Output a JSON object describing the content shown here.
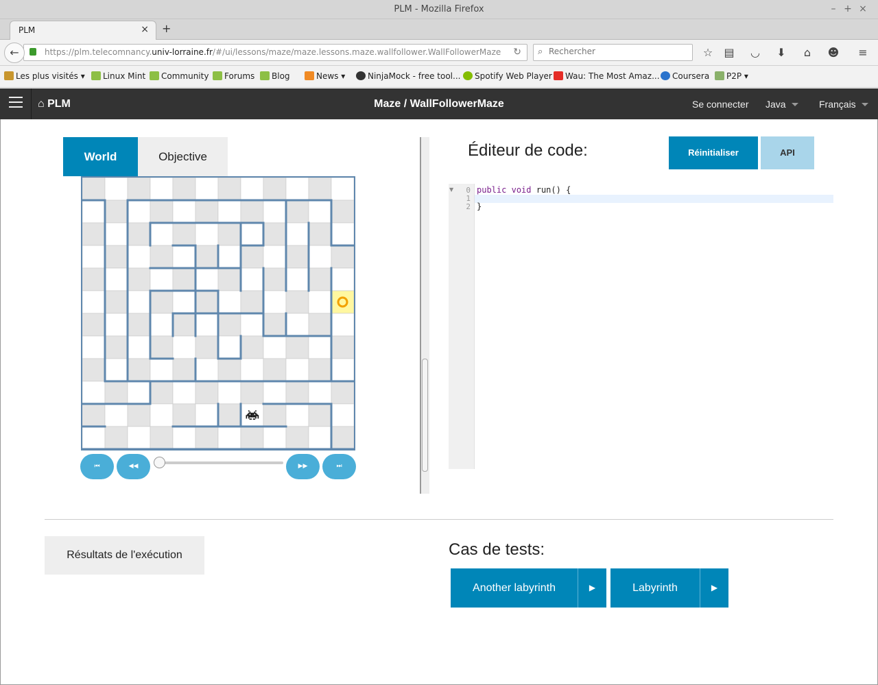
{
  "browser": {
    "window_title": "PLM - Mozilla Firefox",
    "tab_title": "PLM",
    "url_prefix": "https://plm.telecomnancy.",
    "url_domain": "univ-lorraine.fr",
    "url_path": "/#/ui/lessons/maze/maze.lessons.maze.wallfollower.WallFollowerMaze",
    "search_placeholder": "Rechercher",
    "bookmarks": [
      {
        "label": "Les plus visités",
        "icon": "folder-icon",
        "dropdown": true
      },
      {
        "label": "Linux Mint",
        "icon": "mint-icon"
      },
      {
        "label": "Community",
        "icon": "mint-icon"
      },
      {
        "label": "Forums",
        "icon": "mint-icon"
      },
      {
        "label": "Blog",
        "icon": "mint-icon"
      },
      {
        "label": "News",
        "icon": "rss-icon",
        "dropdown": true
      },
      {
        "label": "NinjaMock - free tool...",
        "icon": "ninja-icon"
      },
      {
        "label": "Spotify Web Player",
        "icon": "spotify-icon"
      },
      {
        "label": "Wau: The Most Amaz...",
        "icon": "youtube-icon"
      },
      {
        "label": "Coursera",
        "icon": "coursera-icon"
      },
      {
        "label": "P2P",
        "icon": "folder-icon",
        "dropdown": true
      }
    ]
  },
  "app": {
    "brand": "PLM",
    "title": "Maze / WallFollowerMaze",
    "login": "Se connecter",
    "language": "Java",
    "locale": "Français"
  },
  "world": {
    "tab_world": "World",
    "tab_objective": "Objective",
    "grid_cols": 12,
    "grid_rows": 12,
    "buggle_cell": {
      "col": 7,
      "row": 10
    },
    "goal_cell": {
      "col": 11,
      "row": 5
    },
    "controls": [
      "first",
      "previous",
      "next",
      "last"
    ],
    "control_glyphs": {
      "first": "⏮",
      "previous": "◀◀",
      "next": "▶▶",
      "last": "⏭"
    },
    "slider_value": 0
  },
  "editor": {
    "title": "Éditeur de code:",
    "reset_label": "Réinitialiser",
    "api_label": "API",
    "line_numbers": [
      "0",
      "1",
      "2"
    ],
    "lines": [
      {
        "kw1": "public",
        "kw2": "void",
        "rest": " run() {"
      },
      {
        "text": ""
      },
      {
        "text": "}"
      }
    ]
  },
  "results": {
    "label": "Résultats de l'exécution"
  },
  "tests": {
    "title": "Cas de tests:",
    "cases": [
      {
        "label": "Another labyrinth"
      },
      {
        "label": "Labyrinth"
      }
    ]
  },
  "colors": {
    "accent": "#0086b8",
    "accent_light": "#a9d5ea",
    "wall": "#5f87ad",
    "goal": "#f2a100",
    "header": "#333333"
  }
}
